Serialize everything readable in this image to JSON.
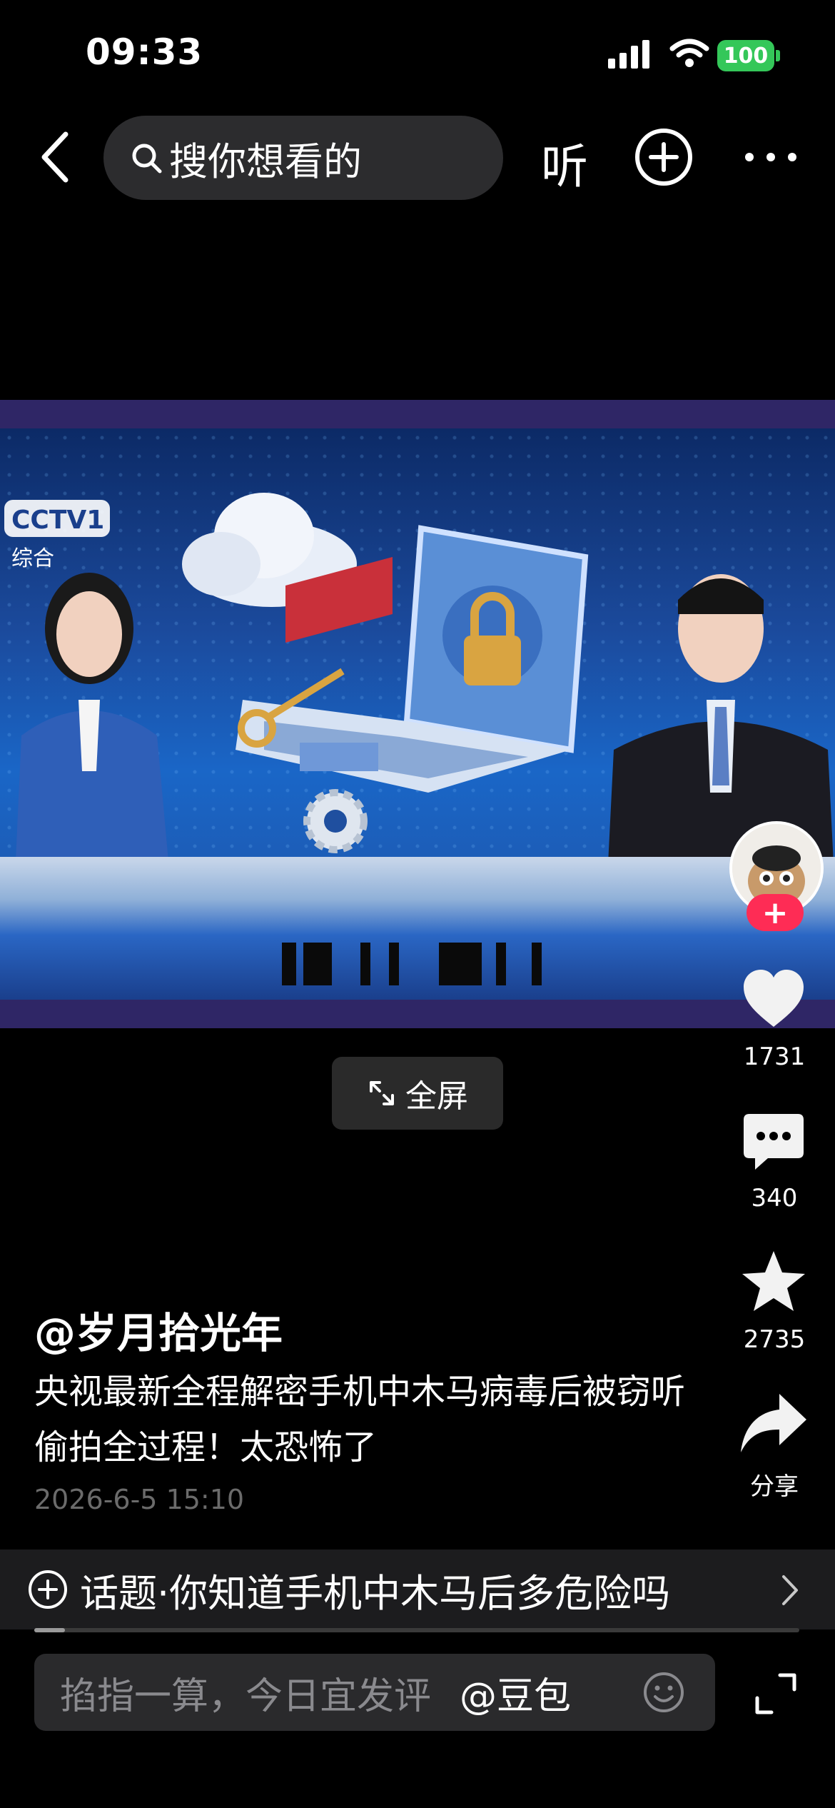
{
  "status_bar": {
    "time": "09:33",
    "battery": "100"
  },
  "header": {
    "search_placeholder": "搜你想看的",
    "listen_label": "听"
  },
  "video": {
    "channel_logo": "CCTV1",
    "channel_sub": "综合"
  },
  "fullscreen_button": {
    "label": "全屏"
  },
  "actions": {
    "likes": "1731",
    "comments": "340",
    "favorites": "2735",
    "share_label": "分享"
  },
  "post": {
    "author": "@岁月拾光年",
    "description": "央视最新全程解密手机中木马病毒后被窃听偷拍全过程！太恐怖了",
    "date": "2026-6-5 15:10"
  },
  "topic": {
    "label": "话题·你知道手机中木马后多危险吗"
  },
  "comment_bar": {
    "placeholder": "掐指一算，今日宜发评",
    "mention": "@豆包"
  },
  "playback": {
    "progress": 0.04
  },
  "colors": {
    "follow_red": "#fe2c55",
    "battery_green": "#34c759"
  }
}
